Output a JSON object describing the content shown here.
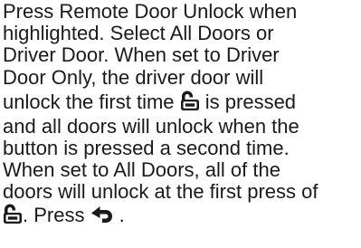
{
  "document": {
    "lines": [
      "Press Remote Door Unlock when",
      "highlighted. Select All Doors or",
      "Driver Door. When set to Driver",
      "Door Only, the driver door will",
      "unlock the first time",
      "is pressed",
      "and all doors will unlock when the",
      "button is pressed a second time.",
      "When set to All Doors, all of the",
      "doors will unlock at the first press of",
      ". Press",
      "."
    ],
    "icons": {
      "unlock": "unlock-icon",
      "back": "back-arrow-icon"
    },
    "text_color": "#1a1a1a"
  }
}
